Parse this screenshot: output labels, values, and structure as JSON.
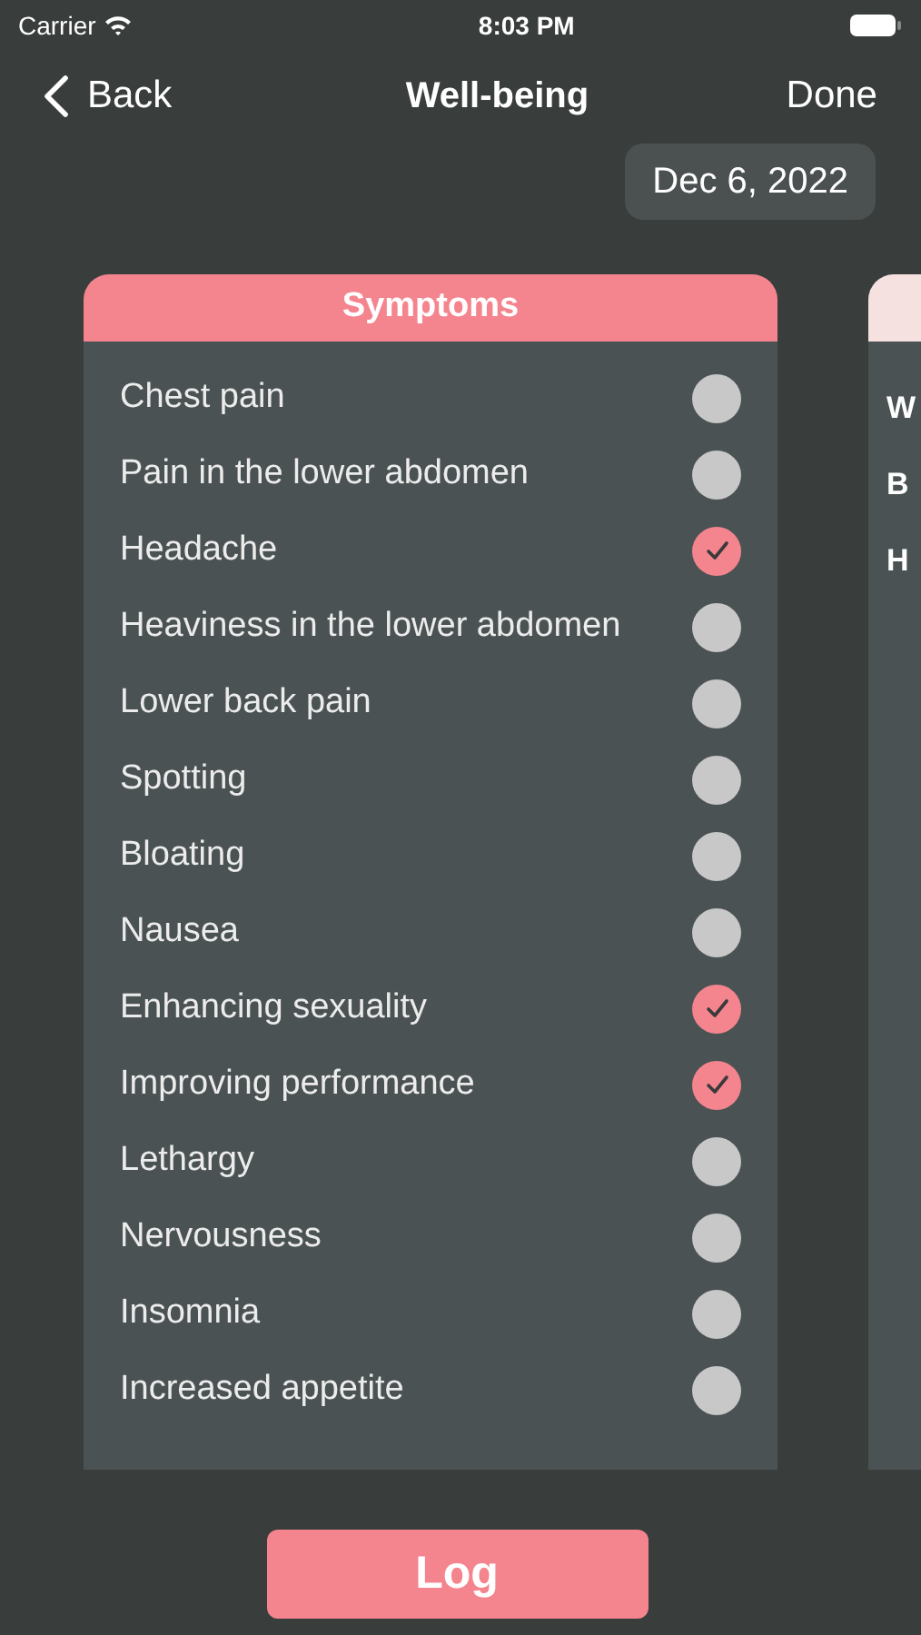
{
  "status_bar": {
    "carrier": "Carrier",
    "time": "8:03 PM"
  },
  "nav": {
    "back": "Back",
    "title": "Well-being",
    "done": "Done"
  },
  "date": "Dec 6, 2022",
  "cards": [
    {
      "title": "Symptoms",
      "items": [
        {
          "label": "Chest pain",
          "checked": false
        },
        {
          "label": "Pain in the lower abdomen",
          "checked": false
        },
        {
          "label": "Headache",
          "checked": true
        },
        {
          "label": "Heaviness in the lower abdomen",
          "checked": false
        },
        {
          "label": "Lower back pain",
          "checked": false
        },
        {
          "label": "Spotting",
          "checked": false
        },
        {
          "label": "Bloating",
          "checked": false
        },
        {
          "label": "Nausea",
          "checked": false
        },
        {
          "label": "Enhancing sexuality",
          "checked": true
        },
        {
          "label": "Improving performance",
          "checked": true
        },
        {
          "label": "Lethargy",
          "checked": false
        },
        {
          "label": "Nervousness",
          "checked": false
        },
        {
          "label": "Insomnia",
          "checked": false
        },
        {
          "label": "Increased appetite",
          "checked": false
        }
      ]
    },
    {
      "items": [
        {
          "label": "W"
        },
        {
          "label": "B"
        },
        {
          "label": "H"
        }
      ]
    }
  ],
  "log_button": "Log"
}
